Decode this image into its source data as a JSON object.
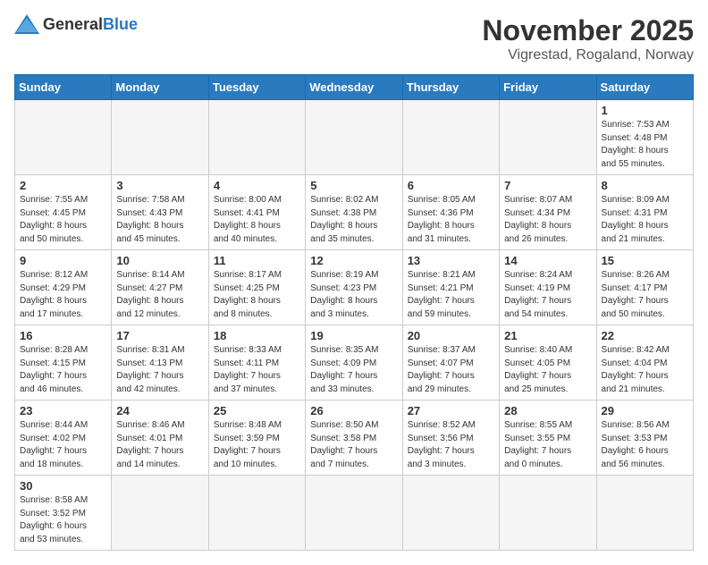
{
  "header": {
    "logo_general": "General",
    "logo_blue": "Blue",
    "month_title": "November 2025",
    "location": "Vigrestad, Rogaland, Norway"
  },
  "weekdays": [
    "Sunday",
    "Monday",
    "Tuesday",
    "Wednesday",
    "Thursday",
    "Friday",
    "Saturday"
  ],
  "weeks": [
    [
      {
        "day": "",
        "info": ""
      },
      {
        "day": "",
        "info": ""
      },
      {
        "day": "",
        "info": ""
      },
      {
        "day": "",
        "info": ""
      },
      {
        "day": "",
        "info": ""
      },
      {
        "day": "",
        "info": ""
      },
      {
        "day": "1",
        "info": "Sunrise: 7:53 AM\nSunset: 4:48 PM\nDaylight: 8 hours\nand 55 minutes."
      }
    ],
    [
      {
        "day": "2",
        "info": "Sunrise: 7:55 AM\nSunset: 4:45 PM\nDaylight: 8 hours\nand 50 minutes."
      },
      {
        "day": "3",
        "info": "Sunrise: 7:58 AM\nSunset: 4:43 PM\nDaylight: 8 hours\nand 45 minutes."
      },
      {
        "day": "4",
        "info": "Sunrise: 8:00 AM\nSunset: 4:41 PM\nDaylight: 8 hours\nand 40 minutes."
      },
      {
        "day": "5",
        "info": "Sunrise: 8:02 AM\nSunset: 4:38 PM\nDaylight: 8 hours\nand 35 minutes."
      },
      {
        "day": "6",
        "info": "Sunrise: 8:05 AM\nSunset: 4:36 PM\nDaylight: 8 hours\nand 31 minutes."
      },
      {
        "day": "7",
        "info": "Sunrise: 8:07 AM\nSunset: 4:34 PM\nDaylight: 8 hours\nand 26 minutes."
      },
      {
        "day": "8",
        "info": "Sunrise: 8:09 AM\nSunset: 4:31 PM\nDaylight: 8 hours\nand 21 minutes."
      }
    ],
    [
      {
        "day": "9",
        "info": "Sunrise: 8:12 AM\nSunset: 4:29 PM\nDaylight: 8 hours\nand 17 minutes."
      },
      {
        "day": "10",
        "info": "Sunrise: 8:14 AM\nSunset: 4:27 PM\nDaylight: 8 hours\nand 12 minutes."
      },
      {
        "day": "11",
        "info": "Sunrise: 8:17 AM\nSunset: 4:25 PM\nDaylight: 8 hours\nand 8 minutes."
      },
      {
        "day": "12",
        "info": "Sunrise: 8:19 AM\nSunset: 4:23 PM\nDaylight: 8 hours\nand 3 minutes."
      },
      {
        "day": "13",
        "info": "Sunrise: 8:21 AM\nSunset: 4:21 PM\nDaylight: 7 hours\nand 59 minutes."
      },
      {
        "day": "14",
        "info": "Sunrise: 8:24 AM\nSunset: 4:19 PM\nDaylight: 7 hours\nand 54 minutes."
      },
      {
        "day": "15",
        "info": "Sunrise: 8:26 AM\nSunset: 4:17 PM\nDaylight: 7 hours\nand 50 minutes."
      }
    ],
    [
      {
        "day": "16",
        "info": "Sunrise: 8:28 AM\nSunset: 4:15 PM\nDaylight: 7 hours\nand 46 minutes."
      },
      {
        "day": "17",
        "info": "Sunrise: 8:31 AM\nSunset: 4:13 PM\nDaylight: 7 hours\nand 42 minutes."
      },
      {
        "day": "18",
        "info": "Sunrise: 8:33 AM\nSunset: 4:11 PM\nDaylight: 7 hours\nand 37 minutes."
      },
      {
        "day": "19",
        "info": "Sunrise: 8:35 AM\nSunset: 4:09 PM\nDaylight: 7 hours\nand 33 minutes."
      },
      {
        "day": "20",
        "info": "Sunrise: 8:37 AM\nSunset: 4:07 PM\nDaylight: 7 hours\nand 29 minutes."
      },
      {
        "day": "21",
        "info": "Sunrise: 8:40 AM\nSunset: 4:05 PM\nDaylight: 7 hours\nand 25 minutes."
      },
      {
        "day": "22",
        "info": "Sunrise: 8:42 AM\nSunset: 4:04 PM\nDaylight: 7 hours\nand 21 minutes."
      }
    ],
    [
      {
        "day": "23",
        "info": "Sunrise: 8:44 AM\nSunset: 4:02 PM\nDaylight: 7 hours\nand 18 minutes."
      },
      {
        "day": "24",
        "info": "Sunrise: 8:46 AM\nSunset: 4:01 PM\nDaylight: 7 hours\nand 14 minutes."
      },
      {
        "day": "25",
        "info": "Sunrise: 8:48 AM\nSunset: 3:59 PM\nDaylight: 7 hours\nand 10 minutes."
      },
      {
        "day": "26",
        "info": "Sunrise: 8:50 AM\nSunset: 3:58 PM\nDaylight: 7 hours\nand 7 minutes."
      },
      {
        "day": "27",
        "info": "Sunrise: 8:52 AM\nSunset: 3:56 PM\nDaylight: 7 hours\nand 3 minutes."
      },
      {
        "day": "28",
        "info": "Sunrise: 8:55 AM\nSunset: 3:55 PM\nDaylight: 7 hours\nand 0 minutes."
      },
      {
        "day": "29",
        "info": "Sunrise: 8:56 AM\nSunset: 3:53 PM\nDaylight: 6 hours\nand 56 minutes."
      }
    ],
    [
      {
        "day": "30",
        "info": "Sunrise: 8:58 AM\nSunset: 3:52 PM\nDaylight: 6 hours\nand 53 minutes."
      },
      {
        "day": "",
        "info": ""
      },
      {
        "day": "",
        "info": ""
      },
      {
        "day": "",
        "info": ""
      },
      {
        "day": "",
        "info": ""
      },
      {
        "day": "",
        "info": ""
      },
      {
        "day": "",
        "info": ""
      }
    ]
  ]
}
